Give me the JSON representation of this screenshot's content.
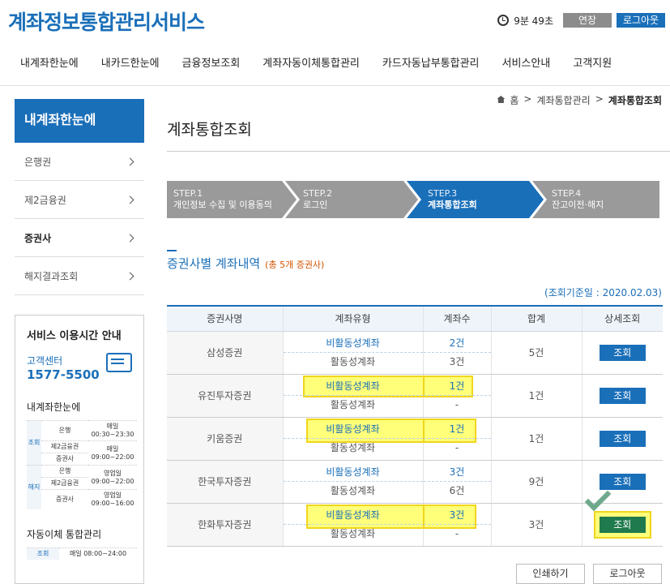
{
  "header": {
    "title": "계좌정보통합관리서비스",
    "timer": "9분 49초",
    "extend_label": "연장",
    "logout_label": "로그아웃"
  },
  "gnb": [
    "내계좌한눈에",
    "내카드한눈에",
    "금융정보조회",
    "계좌자동이체통합관리",
    "카드자동납부통합관리",
    "서비스안내",
    "고객지원"
  ],
  "sidebar": {
    "title": "내계좌한눈에",
    "items": [
      {
        "label": "은행권"
      },
      {
        "label": "제2금융권"
      },
      {
        "label": "증권사"
      },
      {
        "label": "해지결과조회"
      }
    ],
    "service": {
      "title": "서비스 이용시간 안내",
      "cs_label": "고객센터",
      "cs_phone": "1577-5500",
      "sub1": "내계좌한눈에",
      "rows": [
        {
          "grp": "조회",
          "name": "은행",
          "time": "매일 00:30~23:30"
        },
        {
          "grp": "",
          "name": "제2금융권",
          "time": "매일 09:00~22:00"
        },
        {
          "grp": "",
          "name": "증권사",
          "time": ""
        },
        {
          "grp": "해지",
          "name": "은행",
          "time": "영업일 09:00~22:00"
        },
        {
          "grp": "",
          "name": "제2금융권",
          "time": ""
        },
        {
          "grp": "",
          "name": "증권사",
          "time": "영업일 09:00~16:00"
        }
      ],
      "sub2": "자동이체 통합관리",
      "row2": {
        "grp": "조회",
        "time": "매일 08:00~24:00"
      }
    }
  },
  "breadcrumb": {
    "home": "홈",
    "mid": "계좌통합관리",
    "current": "계좌통합조회"
  },
  "page_title": "계좌통합조회",
  "steps": [
    {
      "step": "STEP.1",
      "label": "개인정보 수집 및 이용동의"
    },
    {
      "step": "STEP.2",
      "label": "로그인"
    },
    {
      "step": "STEP.3",
      "label": "계좌통합조회"
    },
    {
      "step": "STEP.4",
      "label": "잔고이전·해지"
    }
  ],
  "section": {
    "title": "증권사별 계좌내역",
    "count": "(총 5개 증권사)",
    "basedate": "(조회기준일 : 2020.02.03)"
  },
  "table": {
    "headers": [
      "증권사명",
      "계좌유형",
      "계좌수",
      "합계",
      "상세조회"
    ],
    "rows": [
      {
        "name": "삼성증권",
        "type1": "비활동성계좌",
        "cnt1": "2건",
        "type2": "활동성계좌",
        "cnt2": "3건",
        "total": "5건",
        "btn": "조회"
      },
      {
        "name": "유진투자증권",
        "type1": "비활동성계좌",
        "cnt1": "1건",
        "type2": "활동성계좌",
        "cnt2": "-",
        "total": "1건",
        "btn": "조회"
      },
      {
        "name": "키움증권",
        "type1": "비활동성계좌",
        "cnt1": "1건",
        "type2": "활동성계좌",
        "cnt2": "-",
        "total": "1건",
        "btn": "조회"
      },
      {
        "name": "한국투자증권",
        "type1": "비활동성계좌",
        "cnt1": "3건",
        "type2": "활동성계좌",
        "cnt2": "6건",
        "total": "9건",
        "btn": "조회"
      },
      {
        "name": "한화투자증권",
        "type1": "비활동성계좌",
        "cnt1": "3건",
        "type2": "활동성계좌",
        "cnt2": "-",
        "total": "3건",
        "btn": "조회"
      }
    ]
  },
  "bottom": {
    "print_label": "인쇄하기",
    "logout_label": "로그아웃"
  },
  "colors": {
    "brand": "#1a6fb9",
    "highlight": "#ffff7a",
    "active_btn": "#1f7a4d"
  }
}
